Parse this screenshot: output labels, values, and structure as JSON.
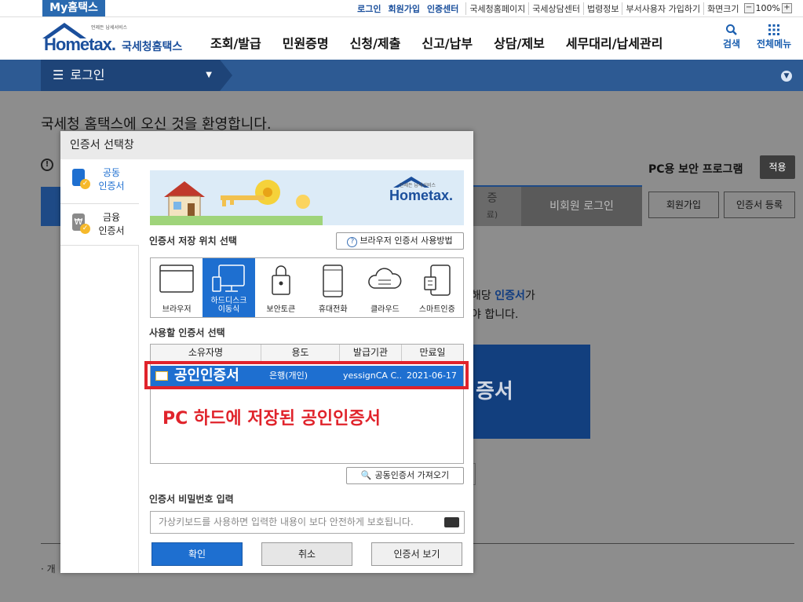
{
  "topbar": {
    "my_hometax": "My홈택스",
    "links_bold": [
      "로그인",
      "회원가입",
      "인증센터"
    ],
    "links": [
      "국세청홈페이지",
      "국세상담센터",
      "법령정보",
      "부서사용자 가입하기",
      "화면크기"
    ],
    "zoom": "100%",
    "zoom_minus": "−",
    "zoom_plus": "+"
  },
  "header": {
    "logo_tiny": "언제든 납세서비스",
    "logo_text": "Hometax.",
    "logo_kr": "국세청홈택스",
    "nav": [
      "조회/발급",
      "민원증명",
      "신청/제출",
      "신고/납부",
      "상담/제보",
      "세무대리/납세관리"
    ],
    "search": "검색",
    "allmenu": "전체메뉴"
  },
  "bluebar": {
    "login": "로그인"
  },
  "background": {
    "welcome": "국세청 홈택스에 오신 것을 환영합니다.",
    "pc_security": "PC용 보안 프로그램",
    "apply": "적용",
    "tabs": [
      "증",
      "비회원 로그인"
    ],
    "tab_sub": "료)",
    "buttons": [
      "회원가입",
      "인증서 등록"
    ],
    "info_line1_a": "해당 ",
    "info_line1_b": "인증서",
    "info_line1_c": "가",
    "info_line2": "야 합니다.",
    "big_button": "증서",
    "footnote": "· 개"
  },
  "modal": {
    "title": "인증서 선택창",
    "side_tabs": [
      {
        "label": "공동\n인증서"
      },
      {
        "label": "금융\n인증서"
      }
    ],
    "banner_tiny": "언제든 납세서비스",
    "banner_logo": "Hometax.",
    "storage_label": "인증서 저장 위치 선택",
    "howto": "브라우저 인증서 사용방법",
    "stores": [
      "브라우저",
      "하드디스크\n이동식",
      "보안토큰",
      "휴대전화",
      "클라우드",
      "스마트인증"
    ],
    "cert_label": "사용할 인증서 선택",
    "columns": [
      "소유자명",
      "용도",
      "발급기관",
      "만료일"
    ],
    "cert_row": {
      "owner": "공인인증서",
      "usage": "은행(개인)",
      "issuer": "yessignCA C...",
      "expiry": "2021-06-17"
    },
    "annotation": "PC 하드에 저장된 공인인증서",
    "get_cert": "공동인증서 가져오기",
    "pw_label": "인증서 비밀번호 입력",
    "pw_placeholder": "가상키보드를 사용하면 입력한 내용이 보다 안전하게 보호됩니다.",
    "ok": "확인",
    "cancel": "취소",
    "view": "인증서 보기"
  },
  "colors": {
    "brand": "#1b4f9c",
    "select_blue": "#1e6fd0",
    "red": "#e0232b",
    "bar": "#2d5a93",
    "overlay": "#8d8d8d"
  }
}
